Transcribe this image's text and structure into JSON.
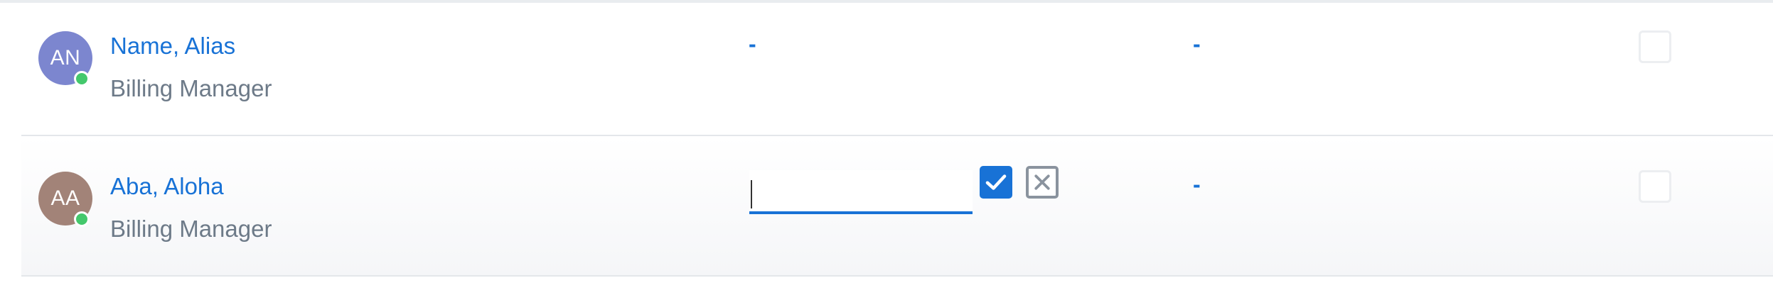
{
  "rows": [
    {
      "initials": "AN",
      "name": "Name, Alias",
      "role": "Billing Manager",
      "col2": "-",
      "col3": "-",
      "avatar_color": "#7c86cf",
      "status": "online"
    },
    {
      "initials": "AA",
      "name": "Aba, Aloha",
      "role": "Billing Manager",
      "edit_value": "",
      "col3": "-",
      "avatar_color": "#a28378",
      "status": "online"
    }
  ],
  "colors": {
    "link": "#1872d6",
    "muted_text": "#6d7a88",
    "presence_online": "#44c86c",
    "confirm": "#1872d6"
  },
  "icons": {
    "confirm": "check-icon",
    "cancel": "close-icon"
  }
}
